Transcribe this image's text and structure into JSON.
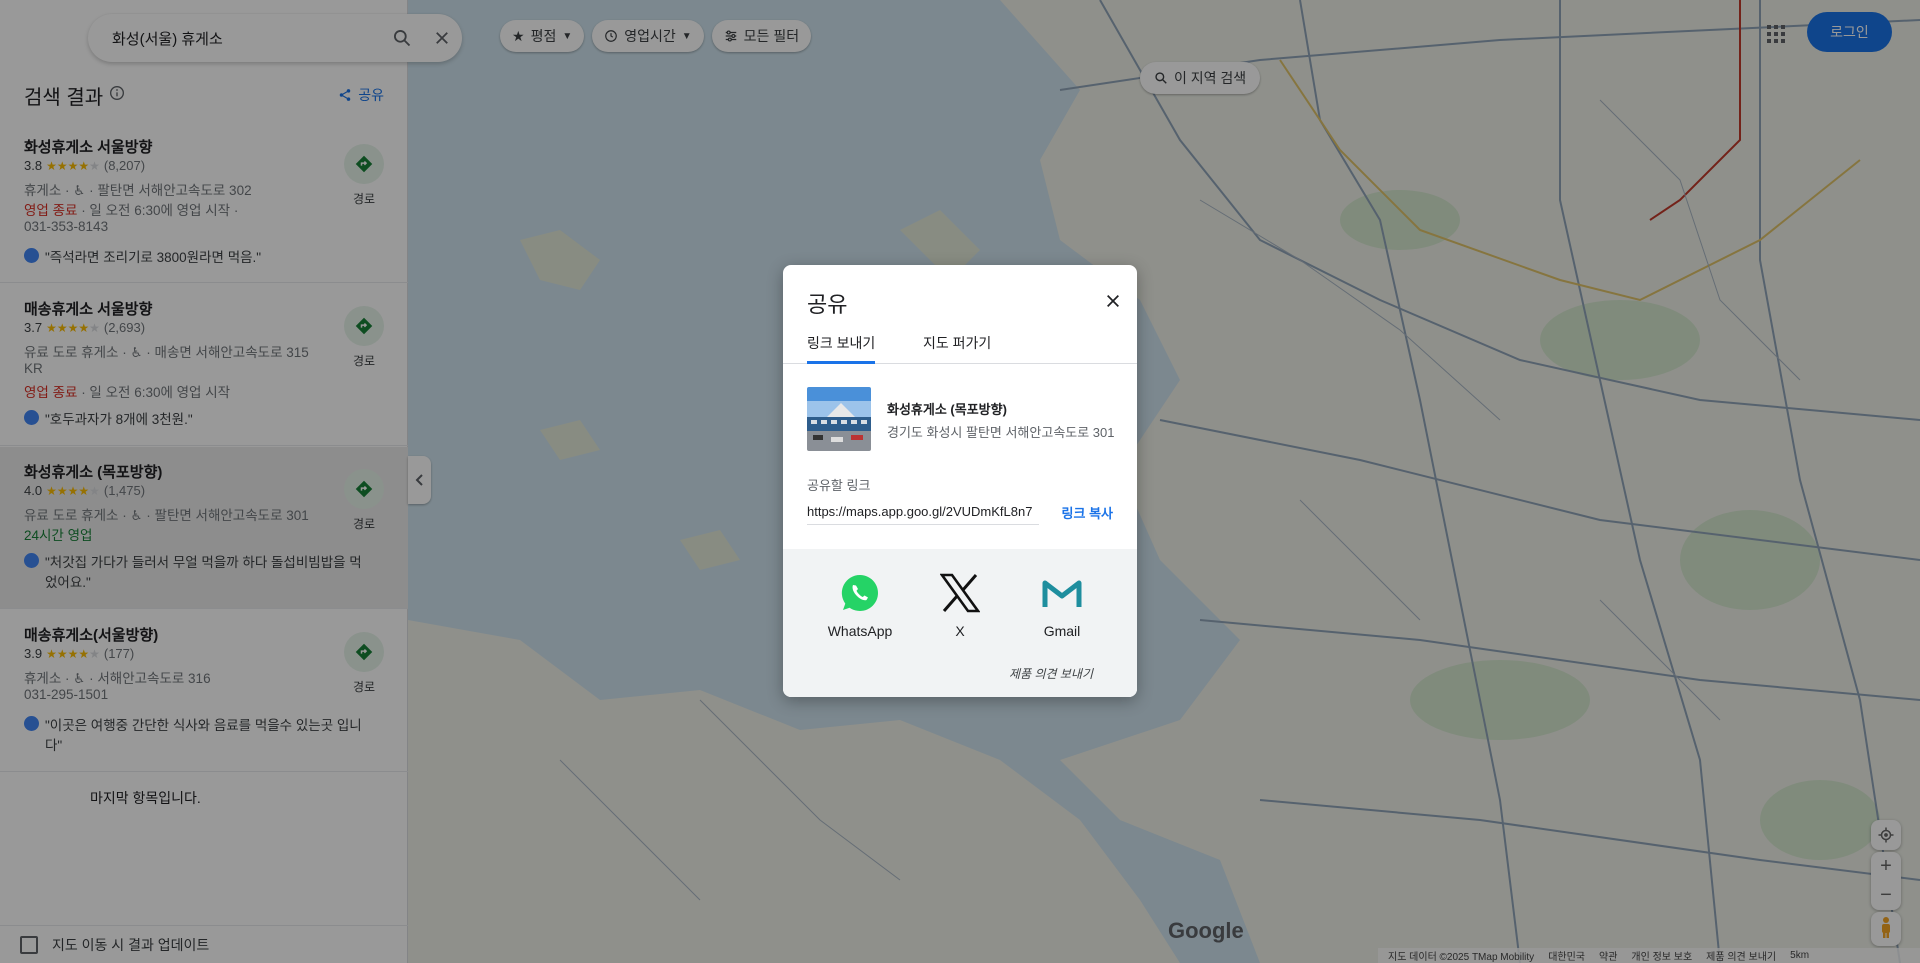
{
  "search": {
    "query": "화성(서울) 휴게소"
  },
  "results_header": {
    "title": "검색 결과",
    "share_label": "공유"
  },
  "results": [
    {
      "name": "화성휴게소 서울방향",
      "rating": "3.8",
      "stars": 3.8,
      "reviews": "(8,207)",
      "line1": "휴게소 · ♿ · 팔탄면 서해안고속도로 302",
      "line2_status": "영업 종료",
      "line2_rest": " · 일 오전 6:30에 영업 시작 ·",
      "line3": "031-353-8143",
      "review": "\"즉석라면 조리기로 3800원라면 먹음.\"",
      "route_label": "경로"
    },
    {
      "name": "매송휴게소 서울방향",
      "rating": "3.7",
      "stars": 3.7,
      "reviews": "(2,693)",
      "line1": "유료 도로 휴게소 · ♿ · 매송면 서해안고속도로 315",
      "line2_plain": "KR",
      "line3_status": "영업 종료",
      "line3_rest": " · 일 오전 6:30에 영업 시작",
      "review": "\"호두과자가 8개에 3천원.\"",
      "route_label": "경로"
    },
    {
      "name": "화성휴게소 (목포방향)",
      "rating": "4.0",
      "stars": 4.0,
      "reviews": "(1,475)",
      "line1": "유료 도로 휴게소 · ♿ · 팔탄면 서해안고속도로 301",
      "line2_open": "24시간 영업",
      "review": "\"처갓집 가다가 들러서 무얼 먹을까 하다 돌섭비빔밥을 먹었어요.\"",
      "route_label": "경로"
    },
    {
      "name": "매송휴게소(서울방향)",
      "rating": "3.9",
      "stars": 3.9,
      "reviews": "(177)",
      "line1": "휴게소 · ♿ · 서해안고속도로 316",
      "line2_plain": "031-295-1501",
      "review": "\"이곳은 여행중 간단한 식사와 음료를 먹을수 있는곳 입니다\"",
      "route_label": "경로"
    }
  ],
  "end_text": "마지막 항목입니다.",
  "update_checkbox_label": "지도 이동 시 결과 업데이트",
  "filters": {
    "rating": "평점",
    "hours": "영업시간",
    "all_filters": "모든 필터"
  },
  "area_search": "이 지역 검색",
  "login": "로그인",
  "google_logo": "Google",
  "attribution": [
    "지도 데이터 ©2025 TMap Mobility",
    "대한민국",
    "약관",
    "개인 정보 보호",
    "제품 의견 보내기",
    "5km"
  ],
  "dialog": {
    "title": "공유",
    "tab_send": "링크 보내기",
    "tab_embed": "지도 퍼가기",
    "place_name": "화성휴게소 (목포방향)",
    "place_address": "경기도 화성시 팔탄면 서해안고속도로 301",
    "link_label": "공유할 링크",
    "link_value": "https://maps.app.goo.gl/2VUDmKfL8n7",
    "copy_label": "링크 복사",
    "apps": [
      "WhatsApp",
      "X",
      "Gmail"
    ],
    "feedback": "제품 의견 보내기"
  },
  "colors": {
    "accent": "#1a73e8",
    "route_green": "#188038",
    "closed_red": "#d93025",
    "star": "#fbbc04",
    "whatsapp": "#25d366",
    "gmail_teal": "#1e8e9e"
  }
}
